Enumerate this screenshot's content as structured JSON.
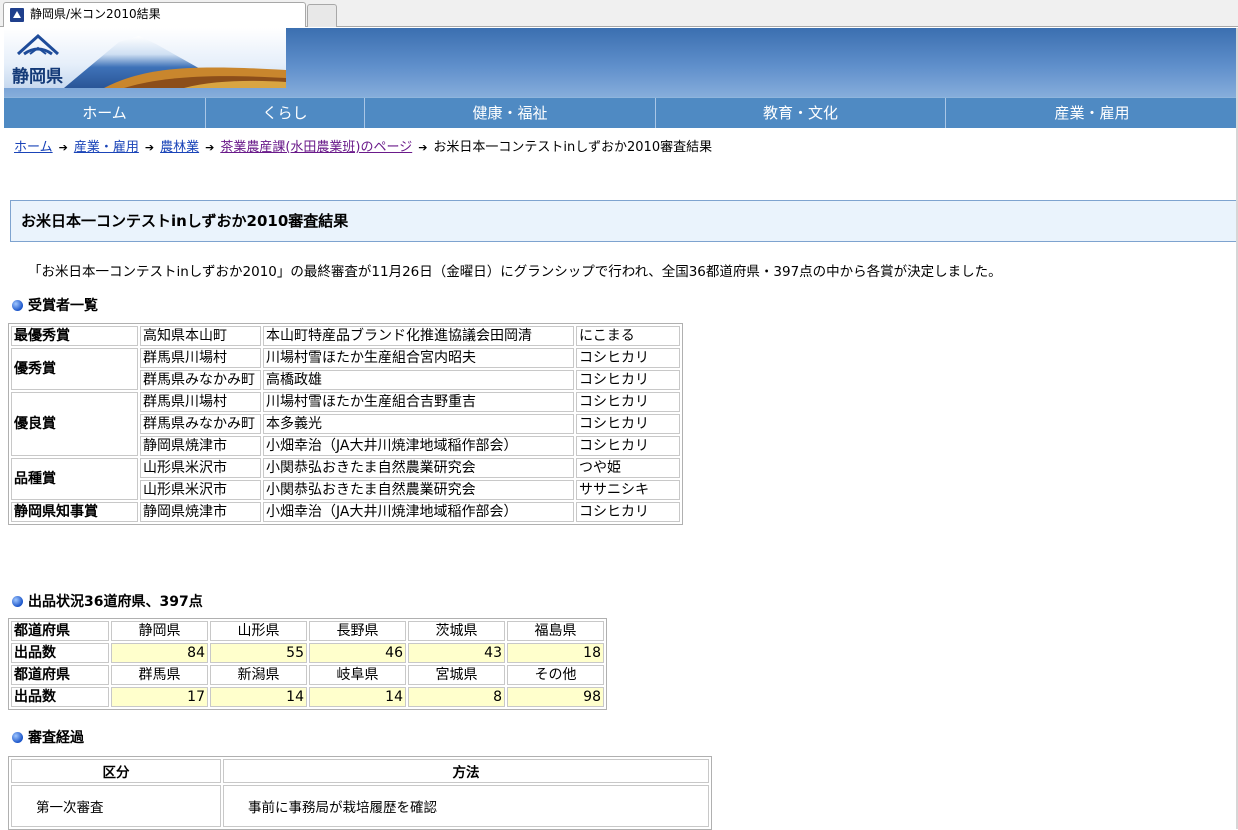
{
  "browser": {
    "tab_title": "静岡県/米コン2010結果",
    "favicon": "shizuoka-favicon-icon"
  },
  "header": {
    "logo_text": "静岡県",
    "colors": {
      "nav": "#4f8ac3",
      "title_bg": "#eaf3fc",
      "highlight": "#ffffcc"
    }
  },
  "nav": {
    "items": [
      {
        "label": "ホーム"
      },
      {
        "label": "くらし"
      },
      {
        "label": "健康・福祉"
      },
      {
        "label": "教育・文化"
      },
      {
        "label": "産業・雇用"
      }
    ]
  },
  "breadcrumb": {
    "items": [
      "ホーム",
      "産業・雇用",
      "農林業",
      "茶業農産課(水田農業班)のページ"
    ],
    "current": "お米日本一コンテストinしずおか2010審査結果"
  },
  "page": {
    "title": "お米日本一コンテストinしずおか2010審査結果",
    "lead": "「お米日本一コンテストinしずおか2010」の最終審査が11月26日（金曜日）にグランシップで行われ、全国36都道府県・397点の中から各賞が決定しました。"
  },
  "awards": {
    "heading": "受賞者一覧",
    "groups": [
      {
        "award": "最優秀賞",
        "rows": [
          {
            "pref": "高知県本山町",
            "name": "本山町特産品ブランド化推進協議会田岡清",
            "variety": "にこまる"
          }
        ]
      },
      {
        "award": "優秀賞",
        "rows": [
          {
            "pref": "群馬県川場村",
            "name": "川場村雪ほたか生産組合宮内昭夫",
            "variety": "コシヒカリ"
          },
          {
            "pref": "群馬県みなかみ町",
            "name": "高橋政雄",
            "variety": "コシヒカリ"
          }
        ]
      },
      {
        "award": "優良賞",
        "rows": [
          {
            "pref": "群馬県川場村",
            "name": "川場村雪ほたか生産組合吉野重吉",
            "variety": "コシヒカリ"
          },
          {
            "pref": "群馬県みなかみ町",
            "name": "本多義光",
            "variety": "コシヒカリ"
          },
          {
            "pref": "静岡県焼津市",
            "name": "小畑幸治（JA大井川焼津地域稲作部会）",
            "variety": "コシヒカリ"
          }
        ]
      },
      {
        "award": "品種賞",
        "rows": [
          {
            "pref": "山形県米沢市",
            "name": "小関恭弘おきたま自然農業研究会",
            "variety": "つや姫"
          },
          {
            "pref": "山形県米沢市",
            "name": "小関恭弘おきたま自然農業研究会",
            "variety": "ササニシキ"
          }
        ]
      },
      {
        "award": "静岡県知事賞",
        "rows": [
          {
            "pref": "静岡県焼津市",
            "name": "小畑幸治（JA大井川焼津地域稲作部会）",
            "variety": "コシヒカリ"
          }
        ]
      }
    ]
  },
  "entries": {
    "heading": "出品状況36道府県、397点",
    "pref_label": "都道府県",
    "count_label": "出品数",
    "rows": [
      {
        "prefs": [
          "静岡県",
          "山形県",
          "長野県",
          "茨城県",
          "福島県"
        ],
        "counts": [
          "84",
          "55",
          "46",
          "43",
          "18"
        ]
      },
      {
        "prefs": [
          "群馬県",
          "新潟県",
          "岐阜県",
          "宮城県",
          "その他"
        ],
        "counts": [
          "17",
          "14",
          "14",
          "8",
          "98"
        ]
      }
    ]
  },
  "process": {
    "heading": "審査経過",
    "col_category": "区分",
    "col_method": "方法",
    "rows": [
      {
        "category": "第一次審査",
        "method": "事前に事務局が栽培履歴を確認"
      }
    ]
  }
}
